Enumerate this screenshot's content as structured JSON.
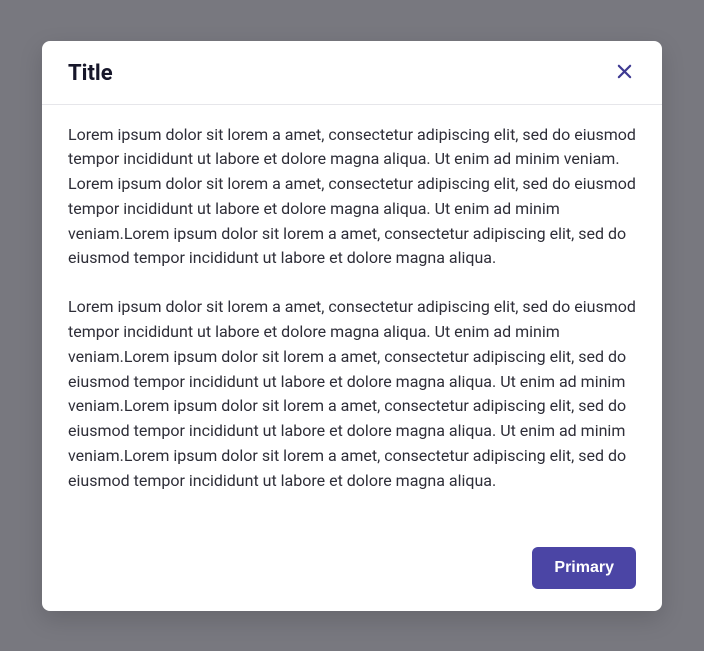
{
  "modal": {
    "title": "Title",
    "close_label": "Close",
    "body": {
      "paragraphs": [
        "Lorem ipsum dolor sit lorem a amet, consectetur adipiscing elit, sed do eiusmod tempor incididunt ut labore et dolore magna aliqua. Ut enim ad minim veniam.\nLorem ipsum dolor sit lorem a amet, consectetur adipiscing elit, sed do eiusmod tempor incididunt ut labore et dolore magna aliqua. Ut enim ad minim veniam.Lorem ipsum dolor sit lorem a amet, consectetur adipiscing elit, sed do eiusmod tempor incididunt ut labore et dolore magna aliqua.",
        "Lorem ipsum dolor sit lorem a amet, consectetur adipiscing elit, sed do eiusmod tempor incididunt ut labore et dolore magna aliqua. Ut enim ad minim veniam.Lorem ipsum dolor sit lorem a amet, consectetur adipiscing elit, sed do eiusmod tempor incididunt ut labore et dolore magna aliqua. Ut enim ad minim veniam.Lorem ipsum dolor sit lorem a amet, consectetur adipiscing elit, sed do eiusmod tempor incididunt ut labore et dolore magna aliqua. Ut enim ad minim veniam.Lorem ipsum dolor sit lorem a amet, consectetur adipiscing elit, sed do eiusmod tempor incididunt ut labore et dolore magna aliqua."
      ]
    },
    "footer": {
      "primary_label": "Primary"
    }
  }
}
